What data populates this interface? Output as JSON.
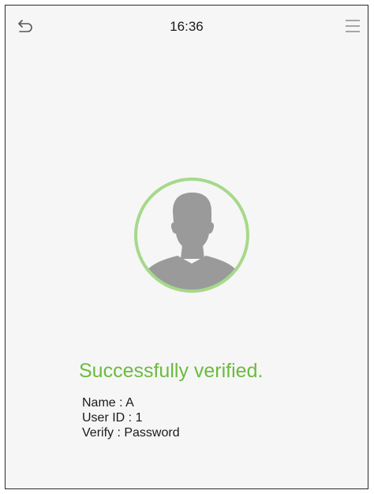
{
  "status_bar": {
    "time": "16:36",
    "back_icon": "back-arrow-icon",
    "menu_icon": "hamburger-menu-icon"
  },
  "verification": {
    "message": "Successfully verified.",
    "name_label": "Name",
    "name_value": "A",
    "name_line": "Name : A",
    "user_id_label": "User ID",
    "user_id_value": "1",
    "user_id_line": "User ID : 1",
    "verify_label": "Verify",
    "verify_value": "Password",
    "verify_line": "Verify : Password"
  },
  "colors": {
    "success": "#6cbb3f",
    "avatar_ring": "#a6d98a",
    "avatar_silhouette": "#9a9a9a",
    "background": "#f6f6f6"
  }
}
